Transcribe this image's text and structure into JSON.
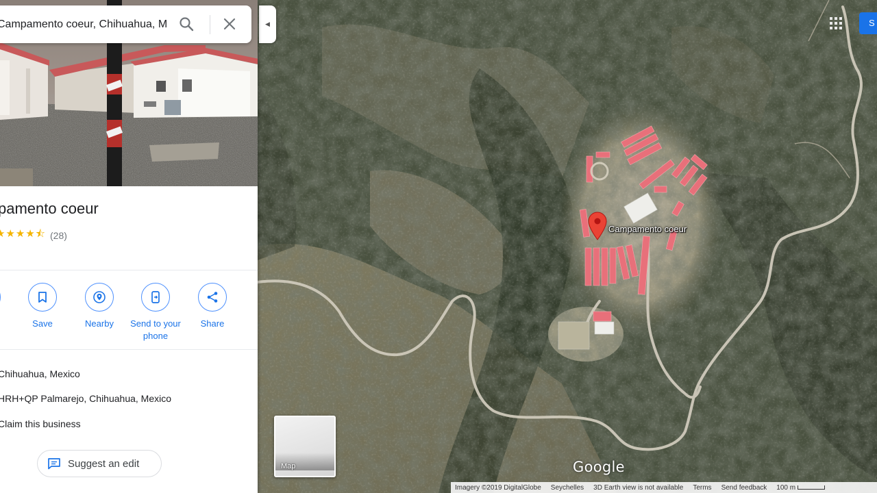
{
  "search": {
    "value": "Campamento coeur, Chihuahua, M",
    "search_icon": "search-icon",
    "close_icon": "close-icon"
  },
  "place": {
    "title": "pamento coeur",
    "rating_stars": "★★★★⯪",
    "review_count": "(28)",
    "rating_value": 4.5
  },
  "actions": [
    {
      "label": "ns",
      "icon": "directions-icon"
    },
    {
      "label": "Save",
      "icon": "bookmark-icon"
    },
    {
      "label": "Nearby",
      "icon": "nearby-icon"
    },
    {
      "label": "Send to your phone",
      "icon": "send-to-phone-icon"
    },
    {
      "label": "Share",
      "icon": "share-icon"
    }
  ],
  "info": {
    "address": "Chihuahua, Mexico",
    "plus_code": "HRH+QP Palmarejo, Chihuahua, Mexico",
    "claim": "Claim this business"
  },
  "suggest_edit": "Suggest an edit",
  "map": {
    "pin_label": "Campamento coeur",
    "logo": "Google",
    "layer_toggle": "Map",
    "top_right_button": "S",
    "footer": {
      "imagery": "Imagery ©2019 DigitalGlobe",
      "country": "Seychelles",
      "earth_notice": "3D Earth view is not available",
      "terms": "Terms",
      "feedback": "Send feedback",
      "scale": "100 m"
    }
  },
  "colors": {
    "accent_blue": "#1a73e8",
    "pin_red": "#ea4335",
    "star_yellow": "#f4b400",
    "roof_red": "#e8707a"
  }
}
